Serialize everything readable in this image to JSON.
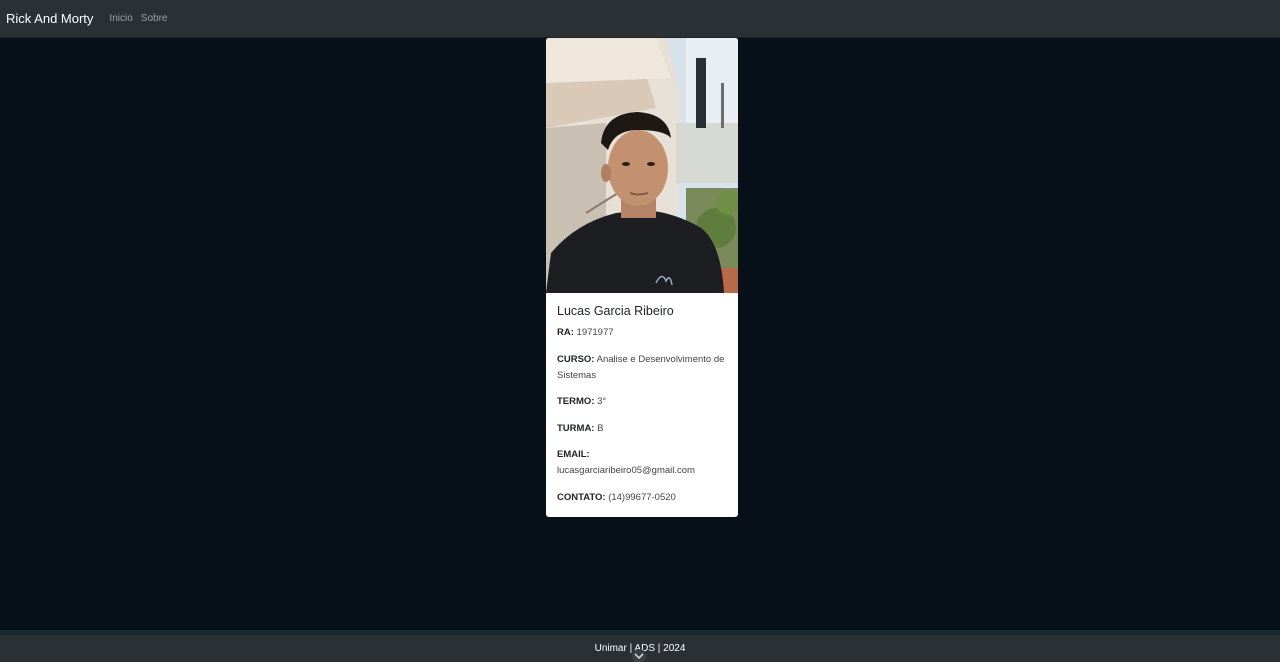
{
  "navbar": {
    "brand": "Rick And Morty",
    "links": [
      "Inicio",
      "Sobre"
    ]
  },
  "card": {
    "photo_alt": "profile-photo",
    "name": "Lucas Garcia Ribeiro",
    "fields": [
      {
        "label": "RA:",
        "value": "1971977"
      },
      {
        "label": "CURSO:",
        "value": "Analise e Desenvolvimento de Sistemas"
      },
      {
        "label": "TERMO:",
        "value": "3°"
      },
      {
        "label": "TURMA:",
        "value": "B"
      },
      {
        "label": "EMAIL:",
        "value": "lucasgarciaribeiro05@gmail.com"
      },
      {
        "label": "CONTATO:",
        "value": "(14)99677-0520"
      }
    ]
  },
  "footer": {
    "text": "Unimar | ADS | 2024"
  },
  "colors": {
    "page_bg": "#08101a",
    "navbar_bg": "#2b3035",
    "card_bg": "#ffffff"
  }
}
